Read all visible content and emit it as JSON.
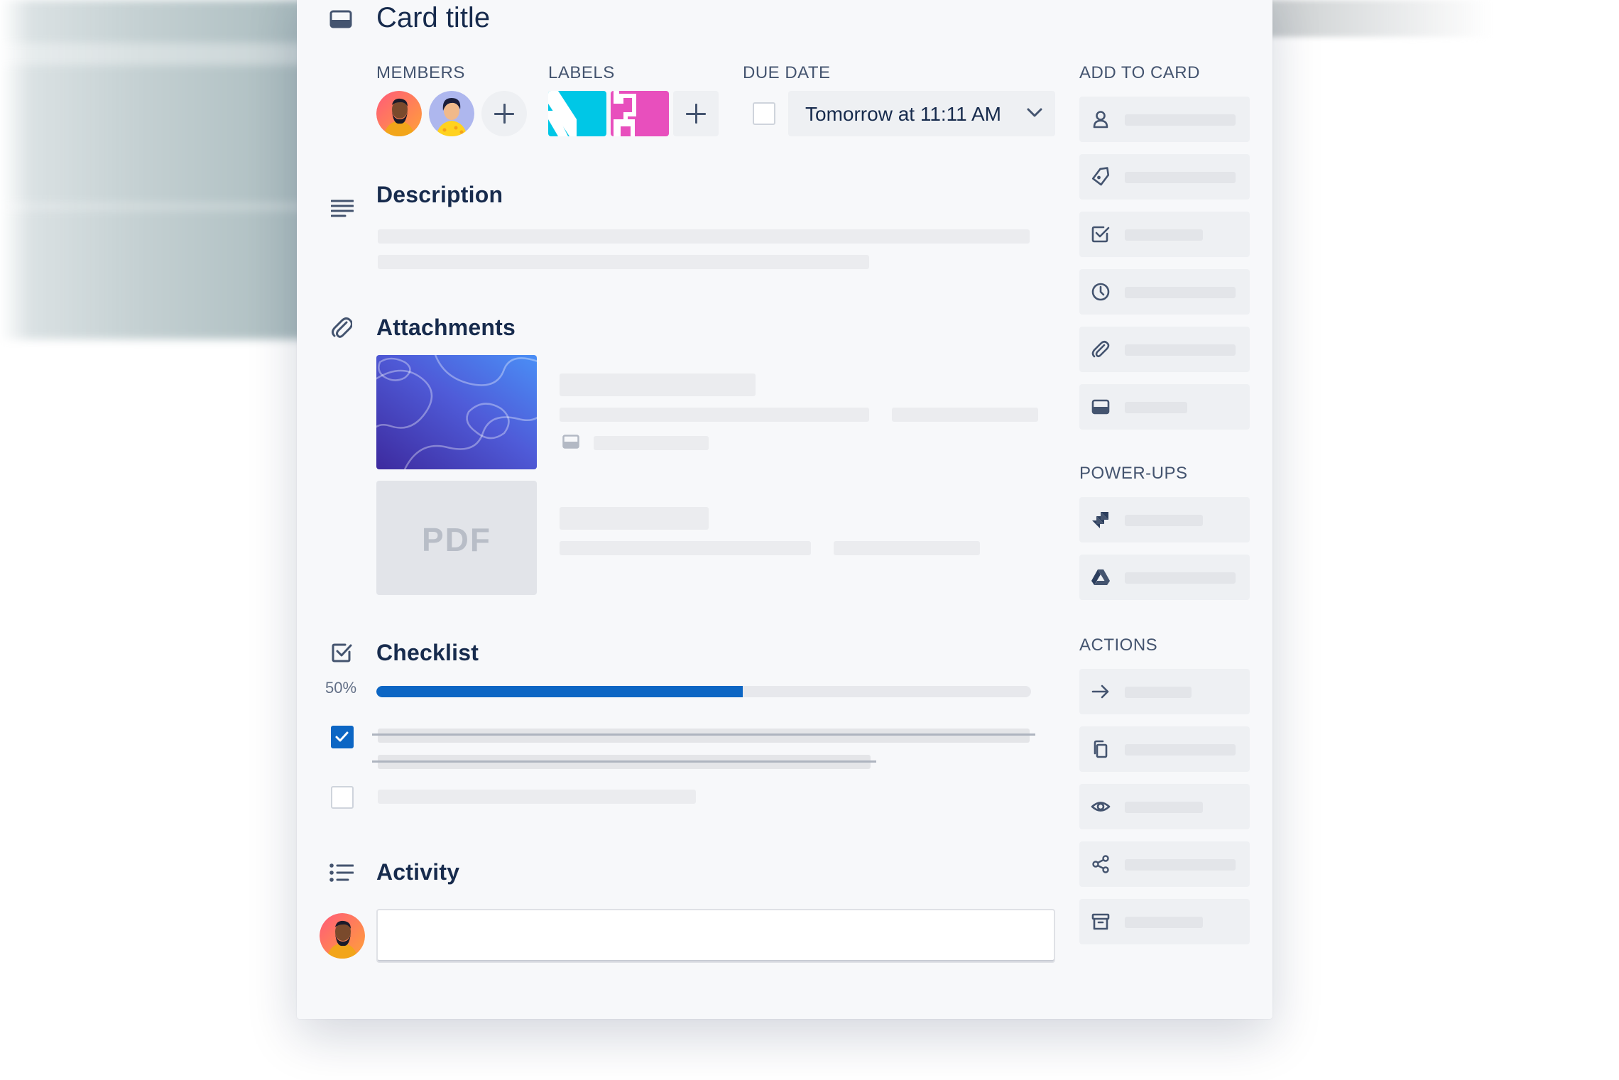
{
  "card": {
    "title": "Card title",
    "members_label": "MEMBERS",
    "labels_label": "LABELS",
    "due_date_label": "DUE DATE",
    "due_date_value": "Tomorrow at 11:11 AM",
    "label_colors": [
      "#00c7e6",
      "#e84fbd"
    ],
    "description_heading": "Description",
    "attachments_heading": "Attachments",
    "pdf_thumb_text": "PDF",
    "checklist_heading": "Checklist",
    "checklist_progress_text": "50%",
    "checklist_progress": 0.56,
    "checklist_items": [
      {
        "checked": true
      },
      {
        "checked": false
      }
    ],
    "activity_heading": "Activity"
  },
  "sidebar": {
    "add_to_card_label": "ADD TO CARD",
    "add_to_card_icons": [
      "person-icon",
      "tag-icon",
      "checklist-icon",
      "clock-icon",
      "paperclip-icon",
      "card-cover-icon"
    ],
    "power_ups_label": "POWER-UPS",
    "power_ups_icons": [
      "jira-icon",
      "google-drive-icon"
    ],
    "actions_label": "ACTIONS",
    "actions_icons": [
      "arrow-right-icon",
      "copy-icon",
      "eye-icon",
      "share-icon",
      "archive-icon"
    ]
  },
  "colors": {
    "accent": "#0c66c4",
    "text_primary": "#172b4d",
    "text_secondary": "#44546f",
    "card_background": "#f7f8fa"
  }
}
